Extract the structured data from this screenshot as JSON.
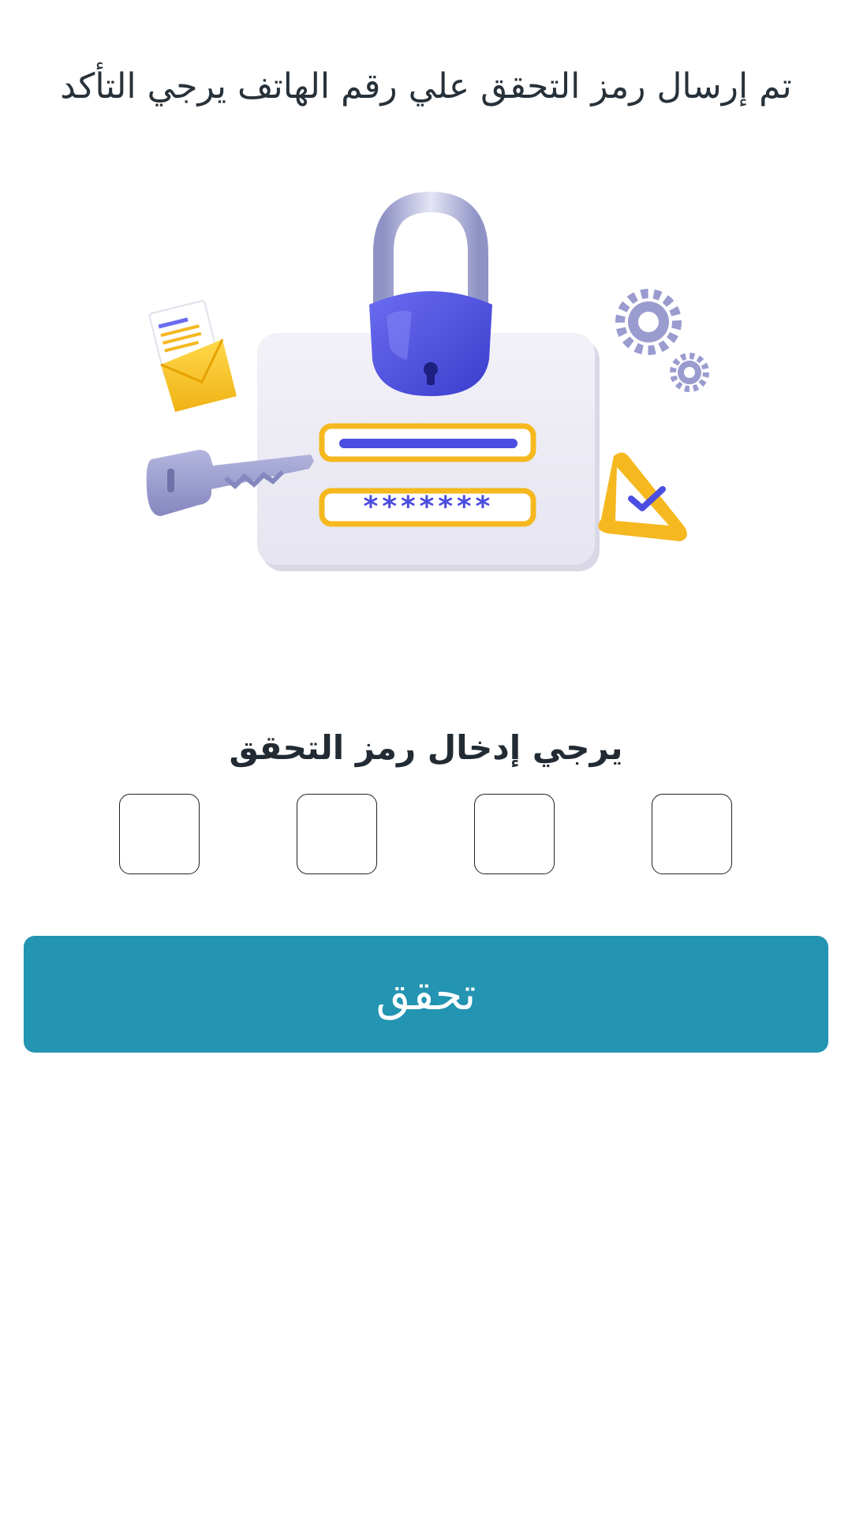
{
  "header": {
    "message": "تم إرسال رمز التحقق علي رقم الهاتف يرجي التأكد"
  },
  "illustration": {
    "masked_password": "*******"
  },
  "otp": {
    "prompt": "يرجي إدخال رمز التحقق",
    "digits": [
      "",
      "",
      "",
      ""
    ]
  },
  "actions": {
    "verify_label": "تحقق"
  },
  "colors": {
    "primary": "#2394b1",
    "text": "#27313a",
    "lock_blue": "#4b4ee0",
    "accent_yellow": "#f5b81f",
    "soft_purple": "#9a9ccf"
  }
}
